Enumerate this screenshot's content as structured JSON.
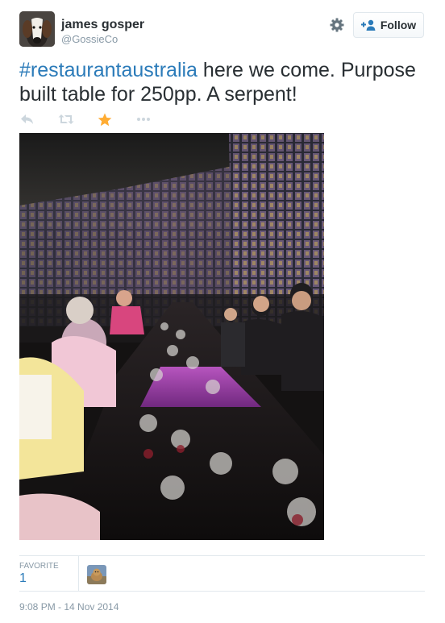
{
  "user": {
    "name": "james gosper",
    "handle": "@GossieCo"
  },
  "follow_button": {
    "label": "Follow"
  },
  "tweet": {
    "hashtag": "#restaurantaustralia",
    "text_after_hashtag": " here we come. Purpose built table for 250pp. A serpent!"
  },
  "actions": [
    "reply-icon",
    "retweet-icon",
    "favorite-icon",
    "more-icon"
  ],
  "colors": {
    "link": "#2b7bb9",
    "favorite_active": "#ffac33",
    "action_gray": "#ccd6dd",
    "muted": "#8899a6"
  },
  "stats": {
    "favorites_label": "FAVORITE",
    "favorites_count": "1"
  },
  "timestamp": "9:08 PM - 14 Nov 2014"
}
